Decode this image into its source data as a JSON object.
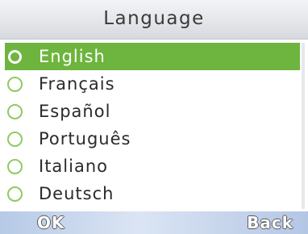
{
  "header": {
    "title": "Language"
  },
  "languages": [
    {
      "label": "English",
      "selected": true
    },
    {
      "label": "Français",
      "selected": false
    },
    {
      "label": "Español",
      "selected": false
    },
    {
      "label": "Português",
      "selected": false
    },
    {
      "label": "Italiano",
      "selected": false
    },
    {
      "label": "Deutsch",
      "selected": false
    }
  ],
  "softkeys": {
    "left": "OK",
    "right": "Back"
  },
  "colors": {
    "accent": "#6db53e",
    "radio_ring": "#8fca62",
    "softkey_bar": "#c7d6ee"
  }
}
